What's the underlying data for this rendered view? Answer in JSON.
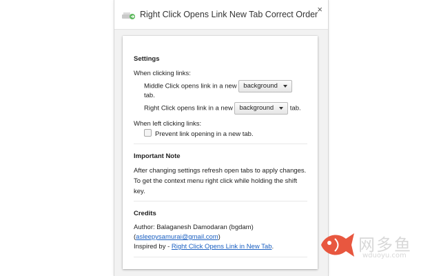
{
  "dialog": {
    "title": "Right Click Opens Link New Tab Correct Order",
    "icon": "green-tab-arrow-icon",
    "close_label": "×"
  },
  "settings": {
    "heading": "Settings",
    "clicking_label": "When clicking links:",
    "middle_prefix": "Middle Click opens link in a new",
    "middle_value": "background",
    "middle_suffix": "tab.",
    "right_prefix": "Right Click opens link in a new",
    "right_value": "background",
    "right_suffix": "tab.",
    "left_clicking_label": "When left clicking links:",
    "prevent_label": "Prevent link opening in a new tab.",
    "prevent_checked": false
  },
  "note": {
    "heading": "Important Note",
    "line1": "After changing settings refresh open tabs to apply changes.",
    "line2": "To get the context menu right click while holding the shift",
    "line3": "key."
  },
  "credits": {
    "heading": "Credits",
    "author": "Author: Balaganesh Damodaran (bgdam)",
    "email_open": "(",
    "email": "asleepysamurai@gmail.com",
    "email_close": ")",
    "inspired_prefix": "Inspired by - ",
    "inspired_link": "Right Click Opens Link in New Tab",
    "inspired_suffix": "."
  },
  "watermark": {
    "text": "网多鱼",
    "url": "wduoyu.com",
    "color": "#e8573f"
  }
}
